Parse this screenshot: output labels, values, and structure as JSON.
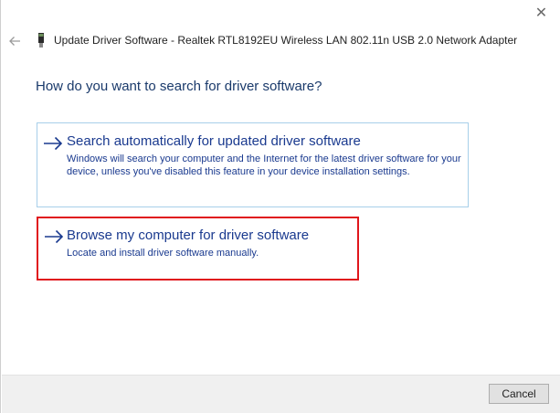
{
  "window": {
    "title": "Update Driver Software - Realtek RTL8192EU Wireless LAN 802.11n USB 2.0 Network Adapter",
    "close_glyph": "✕",
    "back_icon": "back-arrow-icon",
    "device_icon": "usb-device-icon"
  },
  "main": {
    "heading": "How do you want to search for driver software?",
    "options": [
      {
        "title": "Search automatically for updated driver software",
        "description": "Windows will search your computer and the Internet for the latest driver software for your device, unless you've disabled this feature in your device installation settings.",
        "icon": "arrow-right-icon"
      },
      {
        "title": "Browse my computer for driver software",
        "description": "Locate and install driver software manually.",
        "icon": "arrow-right-icon",
        "highlight_color": "#e0161c"
      }
    ]
  },
  "footer": {
    "cancel_label": "Cancel"
  },
  "colors": {
    "link_blue": "#1a3a8f",
    "heading_blue": "#1a3a6b",
    "option_border": "#a7cfe9"
  }
}
